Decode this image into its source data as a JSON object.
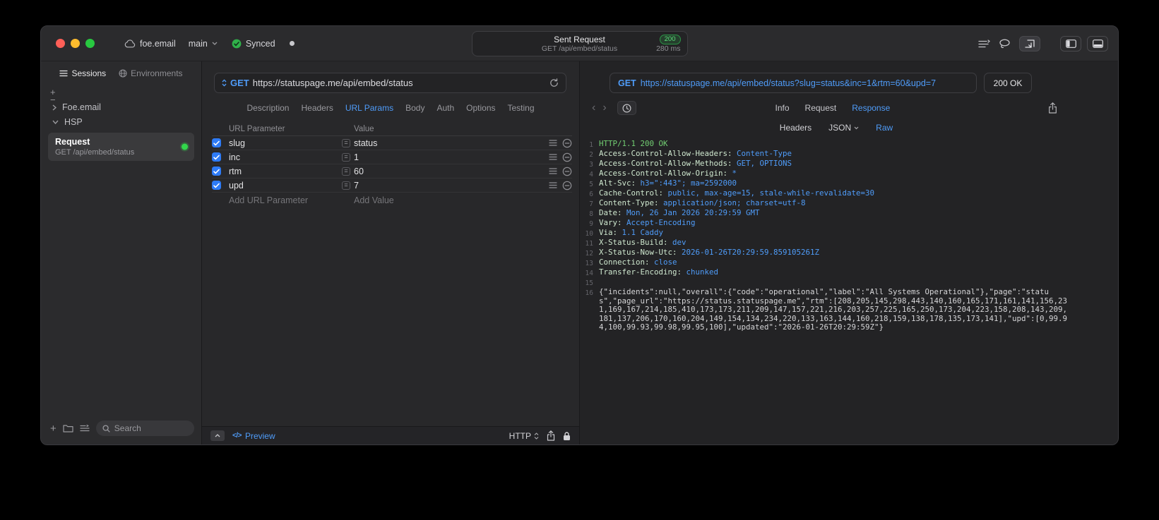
{
  "colors": {
    "accent_blue": "#4F9CF9",
    "success_green": "#32D74B",
    "badge_green": "#5AE07A",
    "window_background": "#2B2B2D",
    "response_background": "#232325"
  },
  "titlebar": {
    "project": "foe.email",
    "branch": "main",
    "sync_status": "Synced",
    "request_title": "Sent Request",
    "status_badge": "200",
    "request_subtitle": "GET /api/embed/status",
    "duration": "280 ms"
  },
  "sidebar": {
    "tabs": [
      {
        "label": "Sessions"
      },
      {
        "label": "Environments"
      }
    ],
    "add_label": "+",
    "remove_label": "−",
    "tree": [
      {
        "label": "Foe.email",
        "state": "collapsed"
      },
      {
        "label": "HSP",
        "state": "expanded"
      }
    ],
    "request_item": {
      "title": "Request",
      "subtitle": "GET /api/embed/status"
    },
    "search_placeholder": "Search"
  },
  "request_panel": {
    "method": "GET",
    "url": "https://statuspage.me/api/embed/status",
    "tabs": [
      "Description",
      "Headers",
      "URL Params",
      "Body",
      "Auth",
      "Options",
      "Testing"
    ],
    "active_tab": "URL Params",
    "table": {
      "name_header": "URL Parameter",
      "value_header": "Value",
      "rows": [
        {
          "name": "slug",
          "value": "status",
          "enabled": true
        },
        {
          "name": "inc",
          "value": "1",
          "enabled": true
        },
        {
          "name": "rtm",
          "value": "60",
          "enabled": true
        },
        {
          "name": "upd",
          "value": "7",
          "enabled": true
        }
      ],
      "add_name_placeholder": "Add URL Parameter",
      "add_value_placeholder": "Add Value"
    },
    "footer": {
      "code_glyph": "</>",
      "preview_label": "Preview",
      "protocol": "HTTP"
    }
  },
  "response_panel": {
    "method": "GET",
    "url": "https://statuspage.me/api/embed/status?slug=status&inc=1&rtm=60&upd=7",
    "status": "200 OK",
    "tabs": [
      "Info",
      "Request",
      "Response"
    ],
    "active_tab": "Response",
    "subtabs": [
      "Headers",
      "JSON",
      "Raw"
    ],
    "active_subtab": "Raw",
    "raw": {
      "status_line": "HTTP/1.1 200 OK",
      "headers": [
        {
          "name": "Access-Control-Allow-Headers",
          "value": "Content-Type"
        },
        {
          "name": "Access-Control-Allow-Methods",
          "value": "GET, OPTIONS"
        },
        {
          "name": "Access-Control-Allow-Origin",
          "value": "*"
        },
        {
          "name": "Alt-Svc",
          "value": "h3=\":443\"; ma=2592000"
        },
        {
          "name": "Cache-Control",
          "value": "public, max-age=15, stale-while-revalidate=30"
        },
        {
          "name": "Content-Type",
          "value": "application/json; charset=utf-8"
        },
        {
          "name": "Date",
          "value": "Mon, 26 Jan 2026 20:29:59 GMT"
        },
        {
          "name": "Vary",
          "value": "Accept-Encoding"
        },
        {
          "name": "Via",
          "value": "1.1 Caddy"
        },
        {
          "name": "X-Status-Build",
          "value": "dev"
        },
        {
          "name": "X-Status-Now-Utc",
          "value": "2026-01-26T20:29:59.859105261Z"
        },
        {
          "name": "Connection",
          "value": "close"
        },
        {
          "name": "Transfer-Encoding",
          "value": "chunked"
        }
      ],
      "body": "{\"incidents\":null,\"overall\":{\"code\":\"operational\",\"label\":\"All Systems Operational\"},\"page\":\"status\",\"page_url\":\"https://status.statuspage.me\",\"rtm\":[208,205,145,298,443,140,160,165,171,161,141,156,231,169,167,214,185,410,173,173,211,209,147,157,221,216,203,257,225,165,250,173,204,223,158,208,143,209,181,137,206,170,160,204,149,154,134,234,220,133,163,144,160,218,159,138,178,135,173,141],\"upd\":[0,99.94,100,99.93,99.98,99.95,100],\"updated\":\"2026-01-26T20:29:59Z\"}"
    }
  }
}
